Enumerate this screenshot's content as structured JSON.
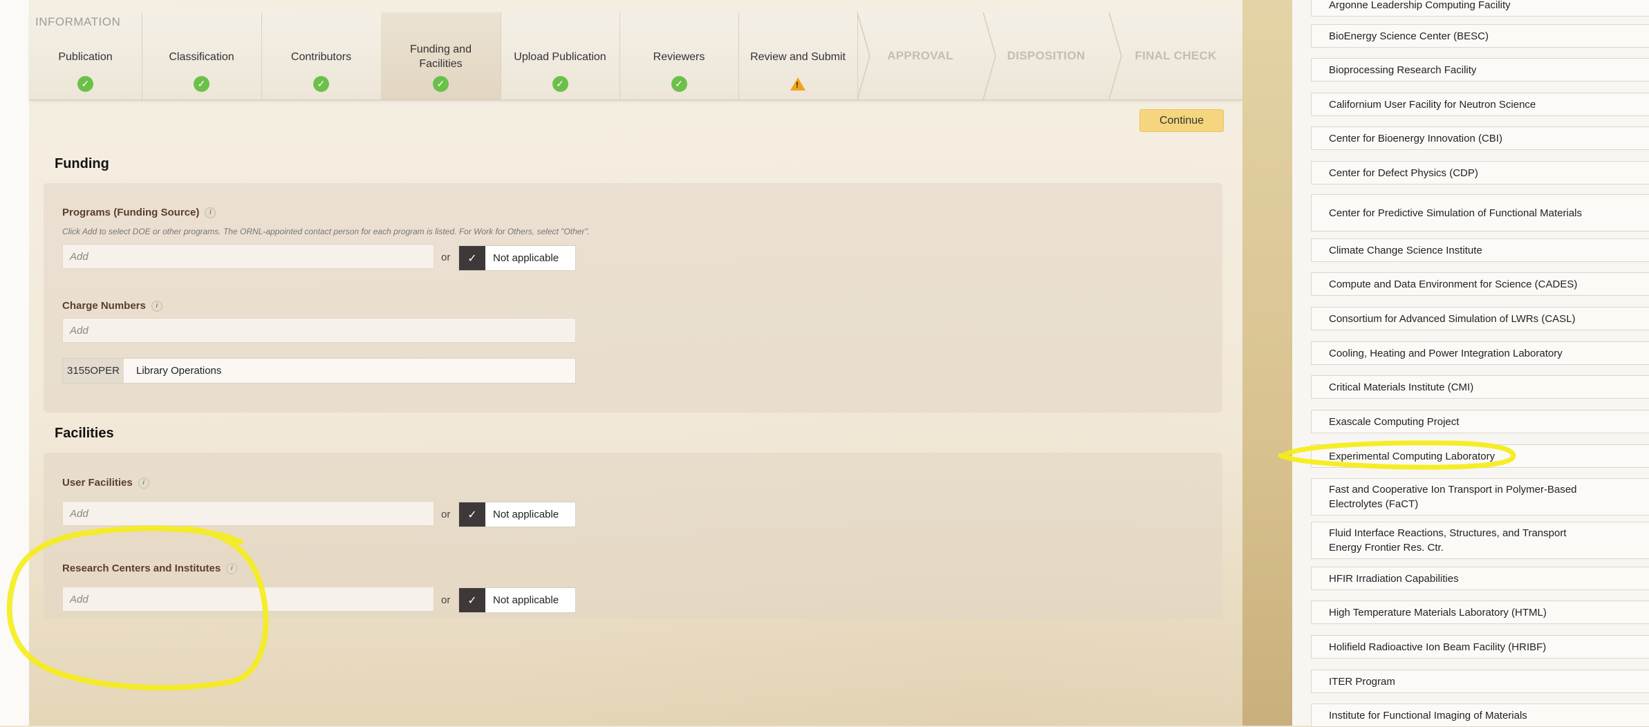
{
  "section_label": "INFORMATION",
  "steps": [
    {
      "label": "Publication",
      "status": "complete"
    },
    {
      "label": "Classification",
      "status": "complete"
    },
    {
      "label": "Contributors",
      "status": "complete"
    },
    {
      "label": "Funding and Facilities",
      "status": "complete"
    },
    {
      "label": "Upload Publication",
      "status": "complete"
    },
    {
      "label": "Reviewers",
      "status": "complete"
    },
    {
      "label": "Review and Submit",
      "status": "warning"
    }
  ],
  "phases": [
    "APPROVAL",
    "DISPOSITION",
    "FINAL CHECK"
  ],
  "continue_label": "Continue",
  "funding": {
    "heading": "Funding",
    "programs_label": "Programs (Funding Source)",
    "programs_hint": "Click Add to select DOE or other programs. The ORNL-appointed contact person for each program is listed. For Work for Others, select \"Other\".",
    "add_placeholder": "Add",
    "or": "or",
    "not_applicable": "Not applicable",
    "charge_label": "Charge Numbers",
    "charge_add": "Add",
    "charge_code": "3155OPER",
    "charge_desc": "Library Operations"
  },
  "facilities": {
    "heading": "Facilities",
    "user_label": "User Facilities",
    "user_add": "Add",
    "or": "or",
    "not_applicable": "Not applicable",
    "research_label": "Research Centers and Institutes",
    "research_add": "Add"
  },
  "facility_list": [
    "Argonne Leadership Computing Facility",
    "BioEnergy Science Center (BESC)",
    "Bioprocessing Research Facility",
    "Californium User Facility for Neutron Science",
    "Center for Bioenergy Innovation (CBI)",
    "Center for Defect Physics (CDP)",
    "Center for Predictive Simulation of Functional Materials",
    "Climate Change Science Institute",
    "Compute and Data Environment for Science (CADES)",
    "Consortium for Advanced Simulation of LWRs (CASL)",
    "Cooling, Heating and Power Integration Laboratory",
    "Critical Materials Institute (CMI)",
    "Exascale Computing Project",
    "Experimental Computing Laboratory",
    "Fast and Cooperative Ion Transport in Polymer-Based Electrolytes (FaCT)",
    "Fluid Interface Reactions, Structures, and Transport Energy Frontier Res. Ctr.",
    "HFIR Irradiation Capabilities",
    "High Temperature Materials Laboratory (HTML)",
    "Holifield Radioactive Ion Beam Facility (HRIBF)",
    "ITER Program",
    "Institute for Functional Imaging of Materials"
  ],
  "colors": {
    "complete": "#6cc04a",
    "warning": "#f0a417",
    "continue": "#f5d57d",
    "annotation": "#f5ec1a"
  }
}
